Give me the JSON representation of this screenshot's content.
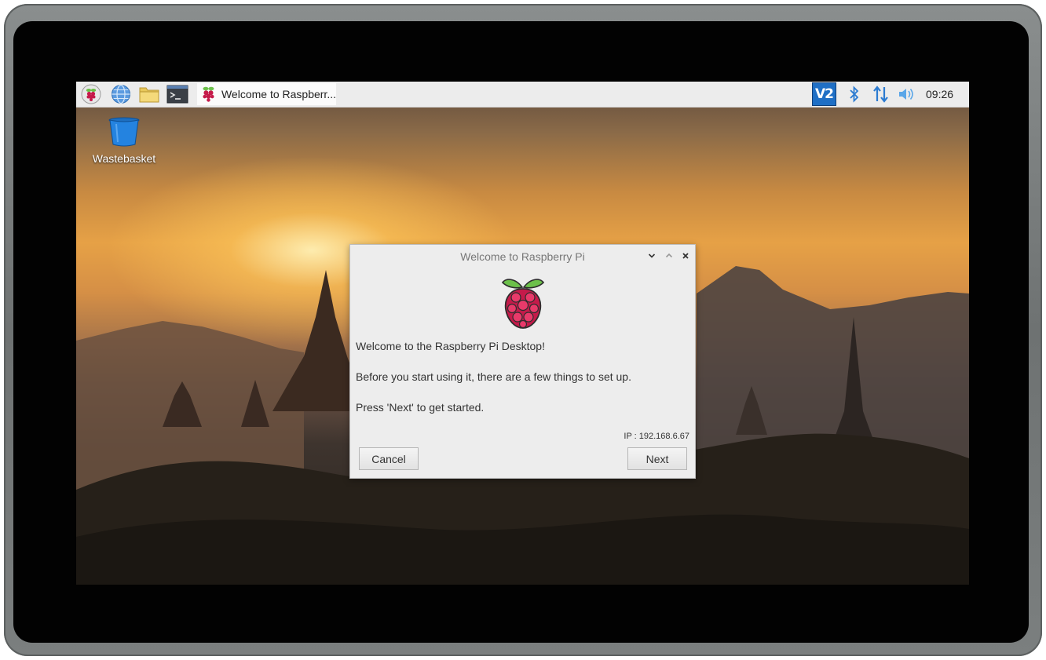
{
  "taskbar": {
    "launchers": [
      {
        "icon": "raspberry-menu-icon"
      },
      {
        "icon": "web-browser-icon"
      },
      {
        "icon": "file-manager-icon"
      },
      {
        "icon": "terminal-icon"
      }
    ],
    "task_label": "Welcome to Raspberr...",
    "tray": {
      "vnc_label": "V2",
      "clock": "09:26"
    }
  },
  "desktop": {
    "icons": [
      {
        "label": "Wastebasket",
        "icon": "wastebasket-icon"
      }
    ]
  },
  "dialog": {
    "title": "Welcome to Raspberry Pi",
    "line1": "Welcome to the Raspberry Pi Desktop!",
    "line2": "Before you start using it, there are a few things to set up.",
    "line3": "Press 'Next' to get started.",
    "ip": "IP : 192.168.6.67",
    "cancel_label": "Cancel",
    "next_label": "Next"
  },
  "colors": {
    "vnc_blue": "#1f6fc5",
    "tray_blue": "#2b7bd1",
    "raspberry_red": "#c51a4a",
    "leaf_green": "#6cc04a"
  }
}
